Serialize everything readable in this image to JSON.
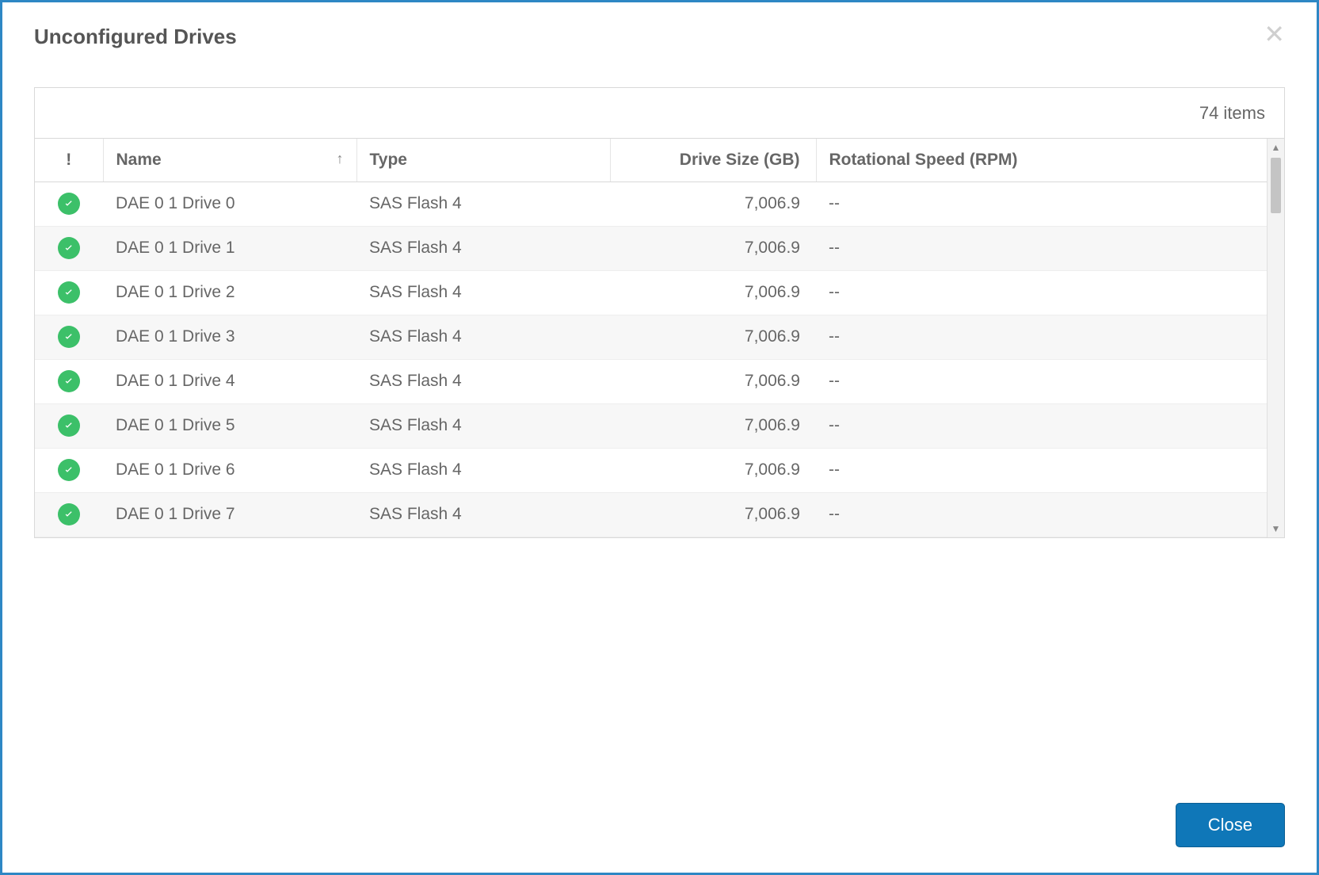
{
  "dialog": {
    "title": "Unconfigured Drives",
    "close_label": "Close"
  },
  "table": {
    "item_count_label": "74 items",
    "columns": {
      "status": "!",
      "name": "Name",
      "type": "Type",
      "size": "Drive Size (GB)",
      "rpm": "Rotational Speed (RPM)"
    },
    "sort": {
      "column": "name",
      "direction": "asc"
    },
    "rows": [
      {
        "status": "ok",
        "name": "DAE 0 1 Drive 0",
        "type": "SAS Flash 4",
        "size": "7,006.9",
        "rpm": "--"
      },
      {
        "status": "ok",
        "name": "DAE 0 1 Drive 1",
        "type": "SAS Flash 4",
        "size": "7,006.9",
        "rpm": "--"
      },
      {
        "status": "ok",
        "name": "DAE 0 1 Drive 2",
        "type": "SAS Flash 4",
        "size": "7,006.9",
        "rpm": "--"
      },
      {
        "status": "ok",
        "name": "DAE 0 1 Drive 3",
        "type": "SAS Flash 4",
        "size": "7,006.9",
        "rpm": "--"
      },
      {
        "status": "ok",
        "name": "DAE 0 1 Drive 4",
        "type": "SAS Flash 4",
        "size": "7,006.9",
        "rpm": "--"
      },
      {
        "status": "ok",
        "name": "DAE 0 1 Drive 5",
        "type": "SAS Flash 4",
        "size": "7,006.9",
        "rpm": "--"
      },
      {
        "status": "ok",
        "name": "DAE 0 1 Drive 6",
        "type": "SAS Flash 4",
        "size": "7,006.9",
        "rpm": "--"
      },
      {
        "status": "ok",
        "name": "DAE 0 1 Drive 7",
        "type": "SAS Flash 4",
        "size": "7,006.9",
        "rpm": "--"
      }
    ]
  }
}
